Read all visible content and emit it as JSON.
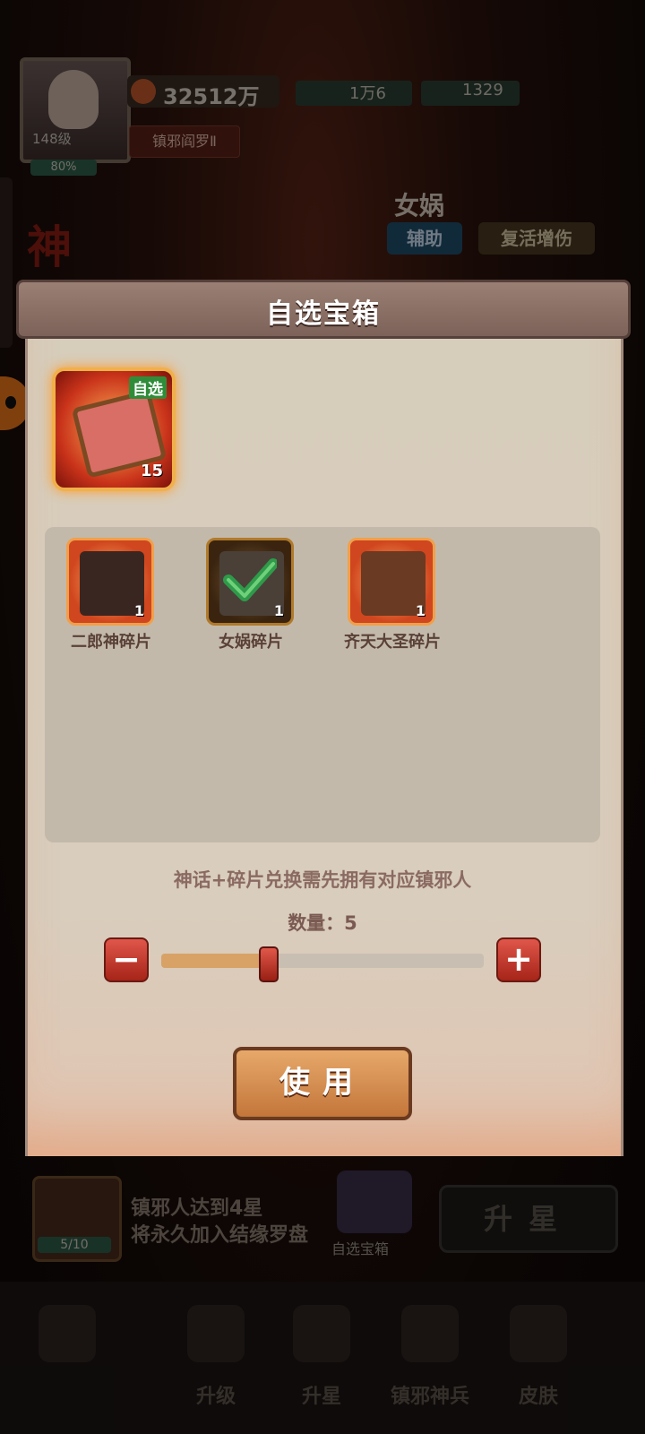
{
  "hud": {
    "level": "148级",
    "exp_percent": "80%",
    "power": "32512万",
    "title_badge": "镇邪阎罗Ⅱ",
    "resource_1": "1万6",
    "resource_2": "1329"
  },
  "hero": {
    "name": "女娲",
    "tag_role": "辅助",
    "tag_skill": "复活增伤",
    "side_char": "神"
  },
  "modal": {
    "title": "自选宝箱",
    "chest": {
      "tag": "自选",
      "count": "15"
    },
    "choices": [
      {
        "label": "二郎神碎片",
        "count": "1",
        "selected": false
      },
      {
        "label": "女娲碎片",
        "count": "1",
        "selected": true
      },
      {
        "label": "齐天大圣碎片",
        "count": "1",
        "selected": false
      }
    ],
    "hint": "神话+碎片兑换需先拥有对应镇邪人",
    "quantity_label": "数量：5",
    "quantity": 5,
    "quantity_max": 15,
    "minus_symbol": "−",
    "plus_symbol": "+",
    "use_button": "使用"
  },
  "background": {
    "fragment_progress": "5/10",
    "star_info_line1": "镇邪人达到4星",
    "star_info_line2": "将永久加入结缘罗盘",
    "box_label": "自选宝箱",
    "upstar_button": "升星"
  },
  "nav": {
    "items": [
      {
        "label": ""
      },
      {
        "label": "升级"
      },
      {
        "label": "升星"
      },
      {
        "label": "镇邪神兵"
      },
      {
        "label": "皮肤"
      }
    ]
  },
  "colors": {
    "accent_red": "#c9331a",
    "check_green": "#2f9a4a",
    "modal_bg": "#d7cdbb"
  }
}
